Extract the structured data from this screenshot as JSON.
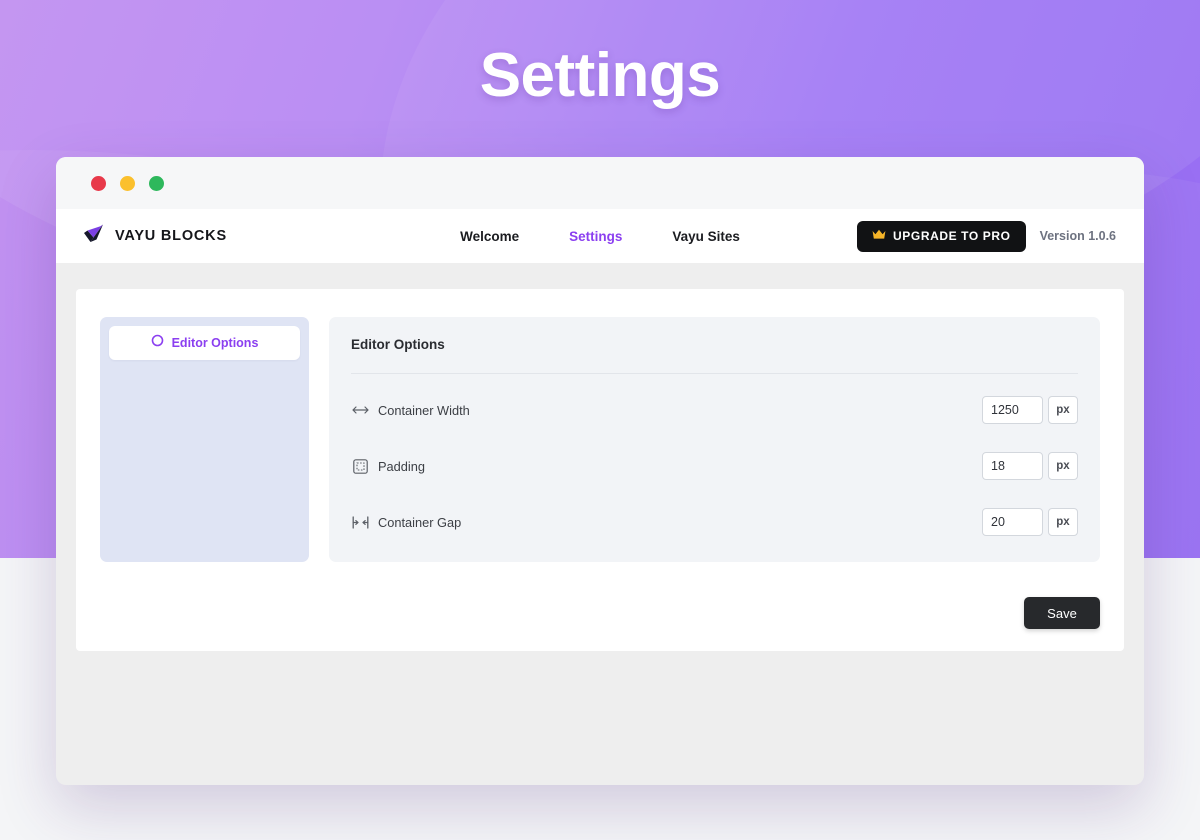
{
  "hero": {
    "title": "Settings",
    "gradient_from": "#c08ef0",
    "gradient_to": "#9063f2"
  },
  "window_controls": {
    "close_label": "close",
    "minimize_label": "minimize",
    "maximize_label": "maximize",
    "close_color": "#e8394a",
    "minimize_color": "#fbc02d",
    "maximize_color": "#2eb85c"
  },
  "navbar": {
    "brand": {
      "name": "VAYU BLOCKS",
      "icon": "checkmark-logo-icon",
      "accent": "#7b3fe4"
    },
    "menu": [
      {
        "label": "Welcome",
        "active": false
      },
      {
        "label": "Settings",
        "active": true
      },
      {
        "label": "Vayu Sites",
        "active": false
      }
    ],
    "upgrade_button": {
      "label": "UPGRADE TO PRO",
      "icon": "crown-icon",
      "background": "#111214",
      "icon_color": "#f5b428"
    },
    "version": "Version 1.0.6",
    "active_color": "#8b3ff0"
  },
  "settings_sidebar": {
    "background": "#dfe4f4",
    "items": [
      {
        "label": "Editor Options",
        "icon": "circle-ring-icon",
        "active": true
      }
    ]
  },
  "settings_card": {
    "title": "Editor Options",
    "rows": [
      {
        "label": "Container Width",
        "icon": "horizontal-arrows-icon",
        "value": "1250",
        "placeholder": "1250",
        "unit": "px"
      },
      {
        "label": "Padding",
        "icon": "padding-square-icon",
        "value": "18",
        "placeholder": "18",
        "unit": "px"
      },
      {
        "label": "Container Gap",
        "icon": "gap-icon",
        "value": "20",
        "placeholder": "20",
        "unit": "px"
      }
    ]
  },
  "footer": {
    "save_label": "Save"
  }
}
